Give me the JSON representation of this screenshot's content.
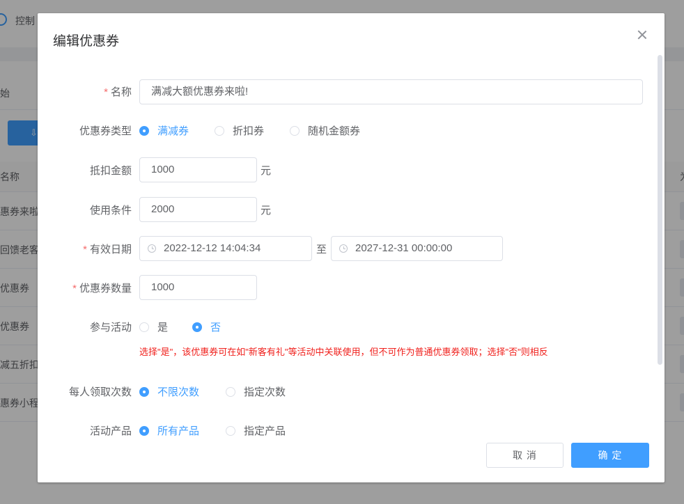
{
  "background": {
    "topbar_text": "控制",
    "filter_text": "始",
    "table_header": "名称",
    "table_header_right": "为",
    "rows": [
      "惠券来啦",
      "回馈老客",
      "优惠券",
      "优惠券",
      "减五折扣",
      "惠券小程"
    ]
  },
  "dialog": {
    "title": "编辑优惠券",
    "fields": {
      "name": {
        "label": "名称",
        "value": "满减大额优惠券来啦!"
      },
      "coupon_type": {
        "label": "优惠券类型",
        "options": [
          "满减券",
          "折扣券",
          "随机金额券"
        ],
        "selected": "满减券"
      },
      "deduct_amount": {
        "label": "抵扣金额",
        "value": "1000",
        "unit": "元"
      },
      "use_condition": {
        "label": "使用条件",
        "value": "2000",
        "unit": "元"
      },
      "valid_date": {
        "label": "有效日期",
        "start": "2022-12-12 14:04:34",
        "separator": "至",
        "end": "2027-12-31 00:00:00"
      },
      "coupon_quantity": {
        "label": "优惠券数量",
        "value": "1000"
      },
      "join_activity": {
        "label": "参与活动",
        "options": [
          "是",
          "否"
        ],
        "selected": "否",
        "hint": "选择\"是\"，该优惠券可在如\"新客有礼\"等活动中关联使用，但不可作为普通优惠券领取；选择\"否\"则相反"
      },
      "claim_times": {
        "label": "每人领取次数",
        "options": [
          "不限次数",
          "指定次数"
        ],
        "selected": "不限次数"
      },
      "products": {
        "label": "活动产品",
        "options": [
          "所有产品",
          "指定产品"
        ],
        "selected": "所有产品"
      }
    },
    "buttons": {
      "cancel": "取 消",
      "confirm": "确 定"
    }
  },
  "colors": {
    "primary": "#409eff",
    "required": "#f56c6c",
    "hint": "#f0201c"
  }
}
